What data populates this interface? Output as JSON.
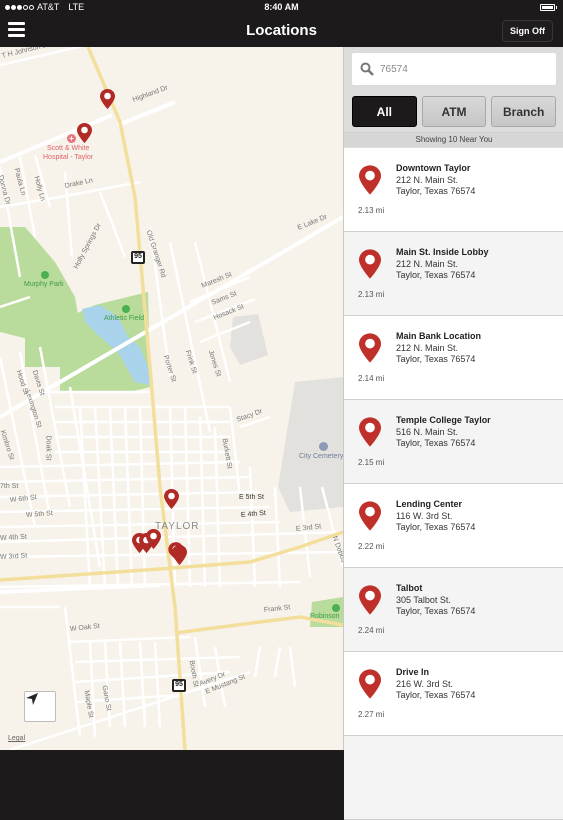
{
  "status_bar": {
    "carrier": "AT&T",
    "network": "LTE",
    "signal_bars": 3,
    "signal_total": 5,
    "time": "8:40 AM"
  },
  "nav": {
    "title": "Locations",
    "sign_off_label": "Sign Off",
    "menu_icon": "hamburger-icon"
  },
  "search": {
    "value": "76574",
    "icon": "search-icon"
  },
  "filters": [
    {
      "label": "All",
      "active": true
    },
    {
      "label": "ATM",
      "active": false
    },
    {
      "label": "Branch",
      "active": false
    }
  ],
  "showing_text": "Showing 10 Near You",
  "locations": [
    {
      "name": "Downtown Taylor",
      "street": "212 N. Main St.",
      "city": "Taylor, Texas 76574",
      "distance": "2.13 mi"
    },
    {
      "name": "Main St. Inside Lobby",
      "street": "212 N. Main St.",
      "city": "Taylor, Texas 76574",
      "distance": "2.13 mi"
    },
    {
      "name": "Main Bank Location",
      "street": "212 N. Main St.",
      "city": "Taylor, Texas 76574",
      "distance": "2.14 mi"
    },
    {
      "name": "Temple College Taylor",
      "street": "516 N. Main St.",
      "city": "Taylor, Texas 76574",
      "distance": "2.15 mi"
    },
    {
      "name": "Lending Center",
      "street": "116 W. 3rd St.",
      "city": "Taylor, Texas 76574",
      "distance": "2.22 mi"
    },
    {
      "name": "Talbot",
      "street": "305 Talbot St.",
      "city": "Taylor, Texas 76574",
      "distance": "2.24 mi"
    },
    {
      "name": "Drive In",
      "street": "216 W. 3rd St.",
      "city": "Taylor, Texas 76574",
      "distance": "2.27 mi"
    }
  ],
  "map": {
    "town_label": "TAYLOR",
    "highway_shield": "95",
    "legal_label": "Legal",
    "pois": {
      "hospital_line1": "Scott & White",
      "hospital_line2": "Hospital - Taylor",
      "park1": "Murphy Park",
      "park2": "Athletic Field",
      "cemetery": "City Cemetery",
      "park3": "Robinson"
    },
    "streets": {
      "th_johnson": "T H Johnson Dr",
      "highland": "Highland Dr",
      "donna": "Donna Dr",
      "paula": "Paula Ln",
      "holly": "Holly Ln",
      "drake": "Drake Ln",
      "holly_springs": "Holly Springs Dr",
      "old_granger": "Old Granger Rd",
      "e_lake": "E Lake Dr",
      "maresh": "Maresh St",
      "sams": "Sams St",
      "hosack": "Hosack St",
      "porter": "Porter St",
      "frink": "Frink St",
      "jones": "Jones St",
      "davis": "Davis St",
      "hood": "Hood St",
      "lexington": "Lexington St",
      "kimbro": "Kimbro St",
      "doak": "Doak St",
      "stacy": "Stacy Dr",
      "burkett": "Burkett St",
      "w7th": "7th St",
      "w6th": "W 6th St",
      "w5th": "W 5th St",
      "w4th": "W 4th St",
      "w3rd": "W 3rd St",
      "e5th": "E 5th St",
      "e4th": "E 4th St",
      "e3rd": "E 3rd St",
      "n_dobbs": "N Dobbs",
      "frank": "Frank St",
      "w_oak": "W Oak St",
      "booth": "Booth St",
      "avery": "Avery Dr",
      "e_mustang": "E Mustang St",
      "maple": "Maple St",
      "gano": "Gano St"
    },
    "accent_color": "#c0302a"
  }
}
